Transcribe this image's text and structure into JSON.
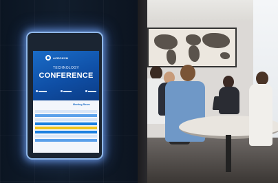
{
  "signage": {
    "brand": "ACRONYM",
    "title_small": "TECHNOLOGY",
    "title_big": "CONFERENCE",
    "schedule_heading": "Meeting Room"
  },
  "colors": {
    "accent_blue": "#1a6cc7",
    "highlight_yellow": "#f2c41a",
    "glow": "#8fb7e8"
  },
  "icons": [
    "calendar-icon",
    "clock-icon",
    "location-icon"
  ]
}
